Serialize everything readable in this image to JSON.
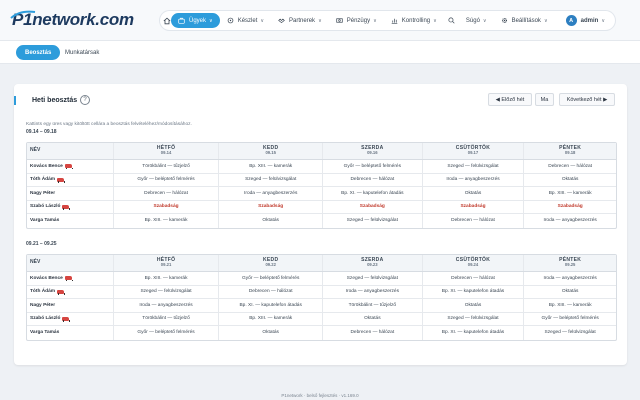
{
  "brand": {
    "name": "network.com",
    "prefix": "P1"
  },
  "nav": {
    "items": [
      {
        "label": "Ügyek",
        "icon": "briefcase-icon",
        "active": true
      },
      {
        "label": "Készlet",
        "icon": "box-icon"
      },
      {
        "label": "Partnerek",
        "icon": "handshake-icon"
      },
      {
        "label": "Pénzügy",
        "icon": "money-icon"
      },
      {
        "label": "Kontrolling",
        "icon": "chart-icon"
      }
    ],
    "help": "Súgó",
    "settings": "Beállítások",
    "user_initial": "A",
    "user": "admin"
  },
  "subtabs": [
    "Beosztás",
    "Munkatársak"
  ],
  "card": {
    "title": "Heti beosztás",
    "help_glyph": "?",
    "prev_button": "◀ Előző hét",
    "today_button": "Ma",
    "next_button": "Következő hét ▶",
    "hint": "Kattints egy üres vagy kitöltött cellára a beosztás felvételéhez/módosításához."
  },
  "name_header": "NÉV",
  "weeks": [
    {
      "label": "09.14 – 09.18",
      "days": [
        {
          "name": "HÉTFŐ",
          "date": "09.14"
        },
        {
          "name": "KEDD",
          "date": "09.15"
        },
        {
          "name": "SZERDA",
          "date": "09.16"
        },
        {
          "name": "CSÜTÖRTÖK",
          "date": "09.17"
        },
        {
          "name": "PÉNTEK",
          "date": "09.18"
        }
      ],
      "rows": [
        {
          "name": "Kovács Bence",
          "car": true,
          "cells": [
            "Törökbálint — tűzjelző",
            "Bp. XIII. — kamerák",
            "Győr — beléptető felmérés",
            "Szeged — felülvizsgálat",
            "Debrecen — hálózat"
          ]
        },
        {
          "name": "Tóth Ádám",
          "car": true,
          "cells": [
            "Győr — beléptető felmérés",
            "Szeged — felülvizsgálat",
            "Debrecen — hálózat",
            "Iroda — anyagbeszerzés",
            "Oktatás"
          ]
        },
        {
          "name": "Nagy Péter",
          "car": false,
          "cells": [
            "Debrecen — hálózat",
            "Iroda — anyagbeszerzés",
            "Bp. XI. — kaputelefon átadás",
            "Oktatás",
            "Bp. XIII. — kamerák"
          ]
        },
        {
          "name": "Szabó László",
          "car": true,
          "cells": [
            "Szabadság",
            "Szabadság",
            "Szabadság",
            "Szabadság",
            "Szabadság"
          ],
          "off": true
        },
        {
          "name": "Varga Tamás",
          "car": false,
          "cells": [
            "Bp. XIII. — kamerák",
            "Oktatás",
            "Szeged — felülvizsgálat",
            "Debrecen — hálózat",
            "Iroda — anyagbeszerzés"
          ]
        }
      ]
    },
    {
      "label": "09.21 – 09.25",
      "days": [
        {
          "name": "HÉTFŐ",
          "date": "09.21"
        },
        {
          "name": "KEDD",
          "date": "09.22"
        },
        {
          "name": "SZERDA",
          "date": "09.23"
        },
        {
          "name": "CSÜTÖRTÖK",
          "date": "09.24"
        },
        {
          "name": "PÉNTEK",
          "date": "09.25"
        }
      ],
      "rows": [
        {
          "name": "Kovács Bence",
          "car": true,
          "cells": [
            "Bp. XIII. — kamerák",
            "Győr — beléptető felmérés",
            "Szeged — felülvizsgálat",
            "Debrecen — hálózat",
            "Iroda — anyagbeszerzés"
          ]
        },
        {
          "name": "Tóth Ádám",
          "car": true,
          "cells": [
            "Szeged — felülvizsgálat",
            "Debrecen — hálózat",
            "Iroda — anyagbeszerzés",
            "Bp. XI. — kaputelefon átadás",
            "Oktatás"
          ]
        },
        {
          "name": "Nagy Péter",
          "car": false,
          "cells": [
            "Iroda — anyagbeszerzés",
            "Bp. XI. — kaputelefon átadás",
            "Törökbálint — tűzjelző",
            "Oktatás",
            "Bp. XIII. — kamerák"
          ]
        },
        {
          "name": "Szabó László",
          "car": true,
          "cells": [
            "Törökbálint — tűzjelző",
            "Bp. XIII. — kamerák",
            "Oktatás",
            "Szeged — felülvizsgálat",
            "Győr — beléptető felmérés"
          ]
        },
        {
          "name": "Varga Tamás",
          "car": false,
          "cells": [
            "Győr — beléptető felmérés",
            "Oktatás",
            "Debrecen — hálózat",
            "Bp. XI. — kaputelefon átadás",
            "Szeged — felülvizsgálat"
          ]
        }
      ]
    }
  ],
  "footer": "P1network · belső fejlesztés · v1.169.0"
}
